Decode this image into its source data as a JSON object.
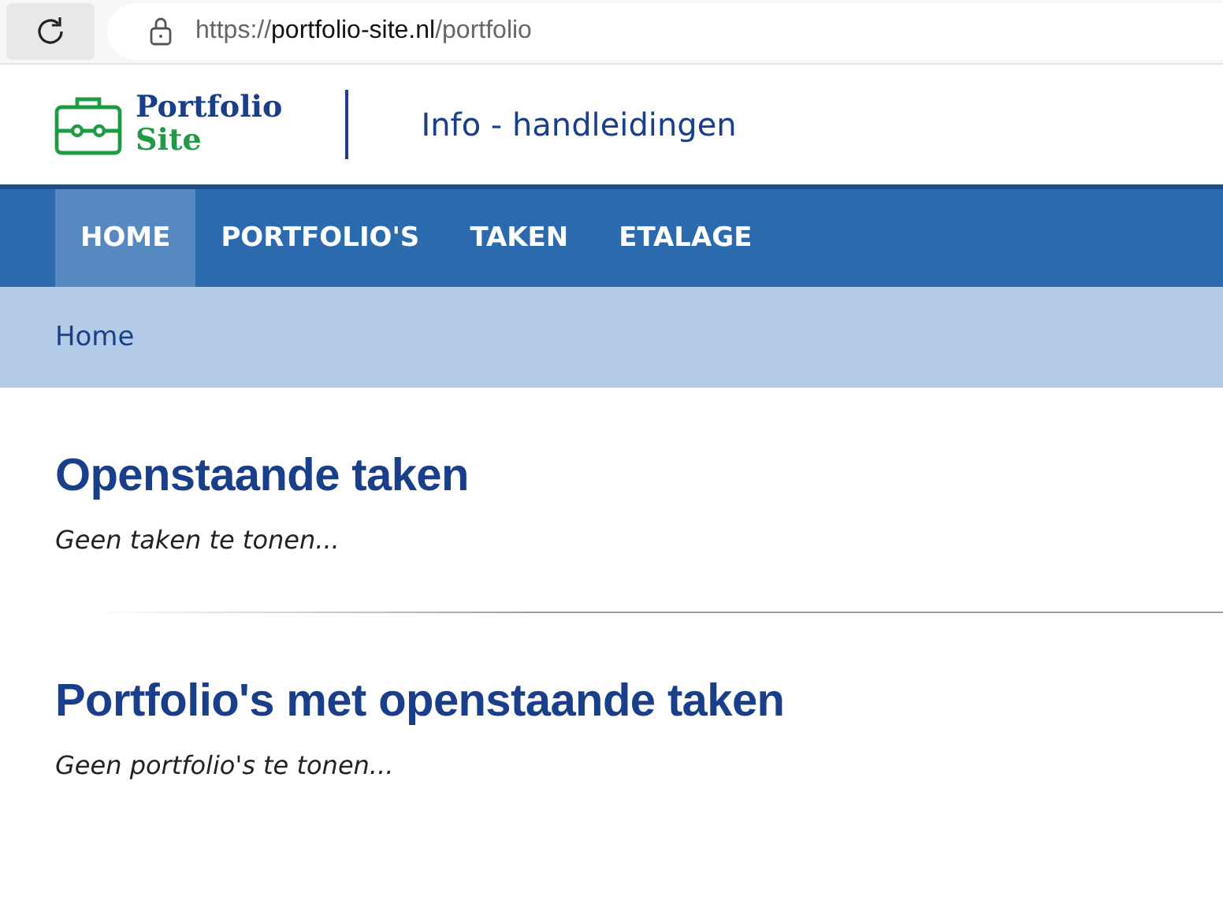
{
  "browser": {
    "url": {
      "scheme": "https://",
      "host": "portfolio-site.nl",
      "path": "/portfolio"
    }
  },
  "header": {
    "logo": {
      "line_1": "Portfolio",
      "line_2": "Site"
    },
    "title": "Info - handleidingen"
  },
  "nav": [
    {
      "label": "HOME",
      "selected": true
    },
    {
      "label": "PORTFOLIO'S",
      "selected": false
    },
    {
      "label": "TAKEN",
      "selected": false
    },
    {
      "label": "ETALAGE",
      "selected": false
    }
  ],
  "breadcrumb": "Home",
  "sections": [
    {
      "heading": "Openstaande taken",
      "empty_text": "Geen taken te tonen..."
    },
    {
      "heading": "Portfolio's met openstaande taken",
      "empty_text": "Geen portfolio's te tonen..."
    }
  ]
}
